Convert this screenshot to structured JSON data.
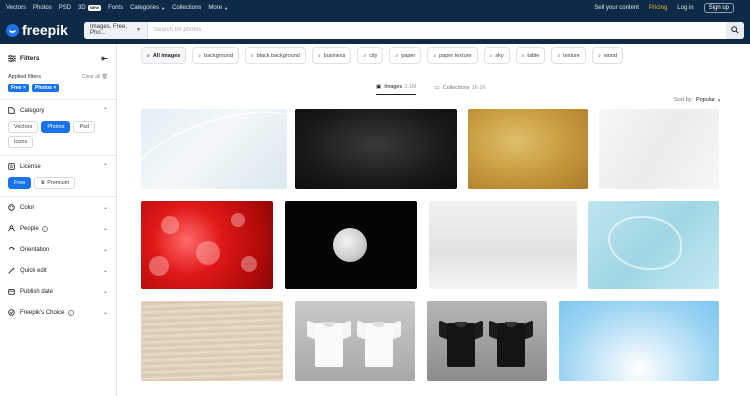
{
  "topnav": {
    "items": [
      "Vectors",
      "Photos",
      "PSD",
      "3D"
    ],
    "new_badge": "NEW",
    "items2": [
      "Fonts",
      "Categories",
      "Collections",
      "More"
    ],
    "sell": "Sell your content",
    "pricing": "Pricing",
    "login": "Log in",
    "signup": "Sign up"
  },
  "header": {
    "logo": "freepik",
    "search_scope": "Images, Free, Pho...",
    "search_placeholder": "Search for photos"
  },
  "sidebar": {
    "title": "Filters",
    "applied_label": "Applied filters",
    "clear_all": "Clear all",
    "chips": [
      "Free",
      "Photos"
    ],
    "category": {
      "title": "Category",
      "options": [
        "Vectors",
        "Photos",
        "Psd",
        "Icons"
      ],
      "active": "Photos"
    },
    "license": {
      "title": "License",
      "options": [
        "Free",
        "Premium"
      ],
      "active": "Free"
    },
    "sections": [
      "Color",
      "People",
      "Orientation",
      "Quick edit",
      "Publish date",
      "Freepik's Choice"
    ]
  },
  "main": {
    "tags": [
      "All images",
      "background",
      "black background",
      "business",
      "city",
      "paper",
      "paper texture",
      "sky",
      "table",
      "texture",
      "wood"
    ],
    "type_tabs": [
      {
        "label": "Images",
        "count": "2.1M"
      },
      {
        "label": "Collections",
        "count": "16.1K"
      }
    ],
    "sort_label": "Sort by:",
    "sort_value": "Popular"
  },
  "colors": {
    "nav_bg": "#0e2a47",
    "accent": "#1a73e8",
    "pricing": "#f2b630"
  }
}
